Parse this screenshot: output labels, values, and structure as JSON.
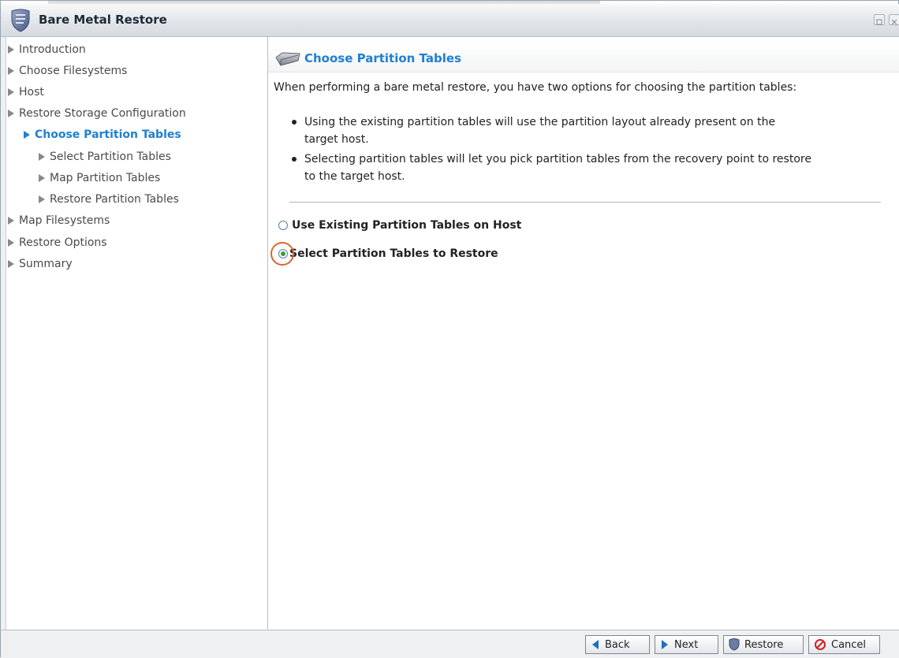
{
  "window": {
    "title": "Bare Metal Restore"
  },
  "sidebar": {
    "items": [
      {
        "label": "Introduction",
        "level": 0,
        "active": false
      },
      {
        "label": "Choose Filesystems",
        "level": 0,
        "active": false
      },
      {
        "label": "Host",
        "level": 0,
        "active": false
      },
      {
        "label": "Restore Storage Configuration",
        "level": 0,
        "active": false
      },
      {
        "label": "Choose Partition Tables",
        "level": 1,
        "active": true
      },
      {
        "label": "Select Partition Tables",
        "level": 2,
        "active": false
      },
      {
        "label": "Map Partition Tables",
        "level": 2,
        "active": false
      },
      {
        "label": "Restore Partition Tables",
        "level": 2,
        "active": false
      },
      {
        "label": "Map Filesystems",
        "level": 0,
        "active": false
      },
      {
        "label": "Restore Options",
        "level": 0,
        "active": false
      },
      {
        "label": "Summary",
        "level": 0,
        "active": false
      }
    ]
  },
  "main": {
    "heading": "Choose Partition Tables",
    "intro": "When performing a bare metal restore, you have two options for choosing the partition tables:",
    "bullets": [
      {
        "line1": "Using the existing partition tables will use the partition layout already present on the",
        "line2": "target host."
      },
      {
        "line1": "Selecting partition tables will let you pick partition tables from the recovery point to restore",
        "line2": "to the target host."
      }
    ],
    "options": [
      {
        "label": "Use Existing Partition Tables on Host",
        "checked": false
      },
      {
        "label": "Select Partition Tables to Restore",
        "checked": true
      }
    ]
  },
  "footer": {
    "back_label": "Back",
    "next_label": "Next",
    "restore_label": "Restore",
    "cancel_label": "Cancel"
  },
  "colors": {
    "accent": "#1f7fd1",
    "highlight": "#e0642a",
    "radio_checked": "#3a9a3a"
  }
}
